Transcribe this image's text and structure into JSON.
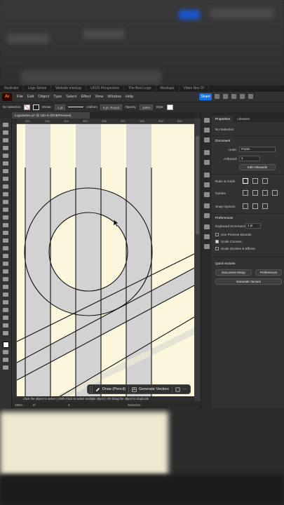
{
  "browser": {
    "tabs": [
      "Illustrator",
      "Logo Series",
      "Website mockup",
      "UI/UX Perspective",
      "The Best Logo",
      "Mockups",
      "Video Nov 07"
    ]
  },
  "menubar": {
    "logo": "Ai",
    "items": [
      "File",
      "Edit",
      "Object",
      "Type",
      "Select",
      "Effect",
      "View",
      "Window",
      "Help"
    ],
    "share_label": "Share"
  },
  "control_bar": {
    "selection": "No Selection",
    "stroke_label": "Stroke:",
    "stroke_value": "1 pt",
    "profile": "Uniform",
    "brush": "5 pt. Round",
    "opacity_label": "Opacity:",
    "opacity_value": "100%",
    "style_label": "Style:"
  },
  "document": {
    "tab_title": "LogoSeries.ai* @ 150 % (RGB/Preview)",
    "ruler_ticks": [
      "252",
      "288",
      "324",
      "360",
      "396",
      "432",
      "468",
      "504",
      "540"
    ]
  },
  "float_bar": {
    "draw_label": "Draw (Pencil)",
    "generate_label": "Generate Vectors"
  },
  "status": {
    "hint": "Click the object to select  |  Shift+Click to select multiple object  |  Alt+Drag the object to duplicate",
    "zoom": "150%",
    "rotation": "0°",
    "artboard_nav": "4",
    "mode": "Selection"
  },
  "properties": {
    "tab_properties": "Properties",
    "tab_libraries": "Libraries",
    "no_selection": "No Selection",
    "document_hdr": "Document",
    "units_label": "Units:",
    "units_value": "Points",
    "artboard_label": "Artboard:",
    "artboard_value": "4",
    "edit_artboards": "Edit Artboards",
    "rulers_grids": "Ruler & Grids",
    "guides": "Guides",
    "snap_options": "Snap Options",
    "preferences_hdr": "Preferences",
    "keyboard_increment_label": "Keyboard Increment:",
    "keyboard_increment_value": "1 pt",
    "use_preview_bounds": "Use Preview Bounds",
    "scale_corners": "Scale Corners",
    "scale_strokes": "Scale Strokes & Effects",
    "quick_actions": "Quick Actions",
    "document_setup": "Document Setup",
    "preferences_btn": "Preferences",
    "generate_vectors": "Generate Vectors"
  },
  "colors": {
    "artboard": "#fcf6dc",
    "shape_fill": "#d2d2d2",
    "accent": "#1473e6"
  }
}
